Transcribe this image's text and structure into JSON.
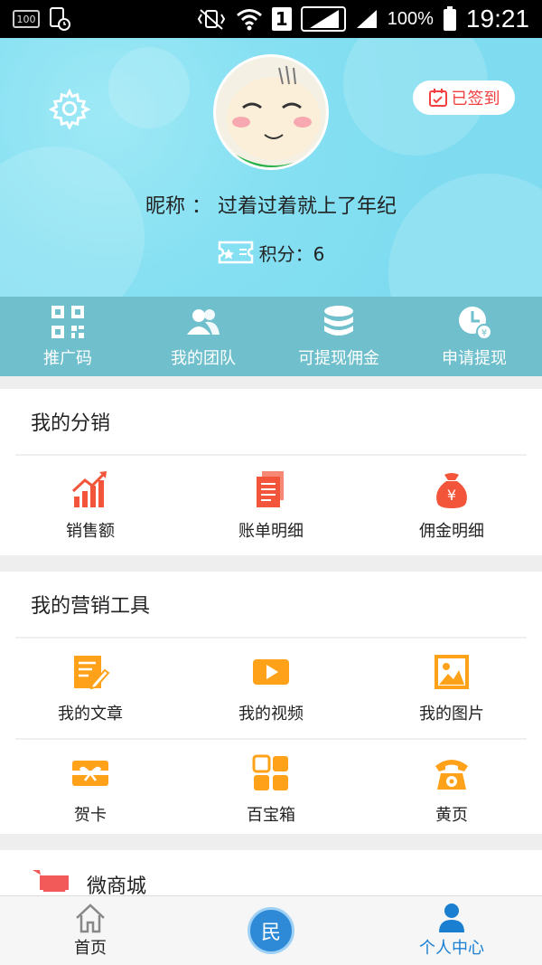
{
  "status_bar": {
    "left_badge": "100",
    "sim": "1",
    "battery_pct": "100%",
    "time": "19:21"
  },
  "header": {
    "checkin_label": "已签到",
    "nickname_label": "昵称 ： 过着过着就上了年纪",
    "points_label": "积分：6"
  },
  "quick_actions": [
    {
      "label": "推广码",
      "icon": "qr-code-icon"
    },
    {
      "label": "我的团队",
      "icon": "team-icon"
    },
    {
      "label": "可提现佣金",
      "icon": "coin-stack-icon"
    },
    {
      "label": "申请提现",
      "icon": "clock-yen-icon"
    }
  ],
  "distribution": {
    "title": "我的分销",
    "items": [
      {
        "label": "销售额",
        "icon": "sales-chart-icon"
      },
      {
        "label": "账单明细",
        "icon": "bill-document-icon"
      },
      {
        "label": "佣金明细",
        "icon": "money-bag-icon"
      }
    ]
  },
  "marketing": {
    "title": "我的营销工具",
    "items": [
      {
        "label": "我的文章",
        "icon": "article-icon"
      },
      {
        "label": "我的视频",
        "icon": "video-icon"
      },
      {
        "label": "我的图片",
        "icon": "image-icon"
      },
      {
        "label": "贺卡",
        "icon": "gift-card-icon"
      },
      {
        "label": "百宝箱",
        "icon": "grid-box-icon"
      },
      {
        "label": "黄页",
        "icon": "telephone-icon"
      }
    ]
  },
  "mall": {
    "title": "微商城"
  },
  "bottom_nav": [
    {
      "label": "首页",
      "icon": "home-icon"
    },
    {
      "label": "民",
      "icon": "center-circle-icon"
    },
    {
      "label": "个人中心",
      "icon": "person-icon"
    }
  ],
  "colors": {
    "header_bg": "#86e0f2",
    "quickbar_bg": "#6fbfcc",
    "accent_red": "#f2553a",
    "accent_orange": "#ffa21a",
    "active_blue": "#1a7fd1"
  }
}
